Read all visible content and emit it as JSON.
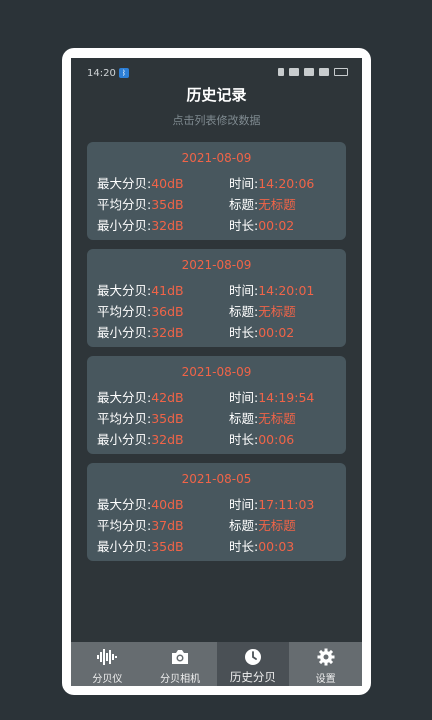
{
  "status": {
    "time": "14:20",
    "bt_glyph": "ᛒ"
  },
  "header": {
    "title": "历史记录",
    "subtitle": "点击列表修改数据"
  },
  "records": [
    {
      "date": "2021-08-09",
      "max_label": "最大分贝:",
      "max": "40dB",
      "avg_label": "平均分贝:",
      "avg": "35dB",
      "min_label": "最小分贝:",
      "min": "32dB",
      "time_label": "时间:",
      "time": "14:20:06",
      "title_label": "标题:",
      "title": "无标题",
      "dur_label": "时长:",
      "duration": "00:02"
    },
    {
      "date": "2021-08-09",
      "max_label": "最大分贝:",
      "max": "41dB",
      "avg_label": "平均分贝:",
      "avg": "36dB",
      "min_label": "最小分贝:",
      "min": "32dB",
      "time_label": "时间:",
      "time": "14:20:01",
      "title_label": "标题:",
      "title": "无标题",
      "dur_label": "时长:",
      "duration": "00:02"
    },
    {
      "date": "2021-08-09",
      "max_label": "最大分贝:",
      "max": "42dB",
      "avg_label": "平均分贝:",
      "avg": "35dB",
      "min_label": "最小分贝:",
      "min": "32dB",
      "time_label": "时间:",
      "time": "14:19:54",
      "title_label": "标题:",
      "title": "无标题",
      "dur_label": "时长:",
      "duration": "00:06"
    },
    {
      "date": "2021-08-05",
      "max_label": "最大分贝:",
      "max": "40dB",
      "avg_label": "平均分贝:",
      "avg": "37dB",
      "min_label": "最小分贝:",
      "min": "35dB",
      "time_label": "时间:",
      "time": "17:11:03",
      "title_label": "标题:",
      "title": "无标题",
      "dur_label": "时长:",
      "duration": "00:03"
    }
  ],
  "nav": [
    {
      "label": "分贝仪",
      "icon": "waveform-icon"
    },
    {
      "label": "分贝相机",
      "icon": "camera-icon"
    },
    {
      "label": "历史分贝",
      "icon": "clock-icon",
      "active": true
    },
    {
      "label": "设置",
      "icon": "gear-icon"
    }
  ],
  "colors": {
    "accent": "#f06448",
    "card": "#48575e",
    "screen": "#2e3539",
    "nav": "#666c70"
  }
}
